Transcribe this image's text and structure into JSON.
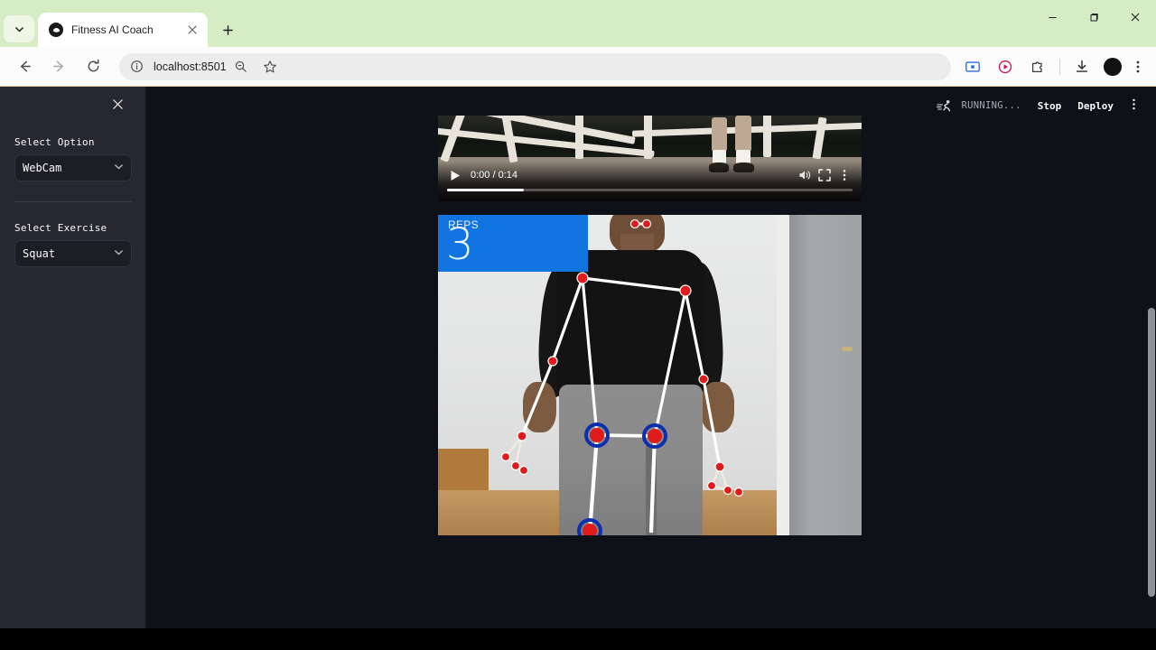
{
  "browser": {
    "tab": {
      "title": "Fitness AI Coach",
      "favicon_icon": "dark-circle-favicon",
      "close_icon": "close-icon"
    },
    "tab_list_icon": "chevron-down-icon",
    "new_tab_icon": "plus-icon",
    "window_controls": {
      "minimize_icon": "minimize-icon",
      "maximize_icon": "maximize-icon",
      "close_icon": "close-icon"
    },
    "toolbar": {
      "back_icon": "back-arrow-icon",
      "forward_icon": "forward-arrow-icon",
      "reload_icon": "reload-icon",
      "site_info_icon": "info-circle-icon",
      "url": "localhost:8501",
      "zoom_icon": "zoom-out-magnifier-icon",
      "bookmark_icon": "star-icon",
      "ext_screen_icon": "screen-capture-icon",
      "ext_record_icon": "record-play-icon",
      "ext_puzzle_icon": "extensions-puzzle-icon",
      "download_icon": "download-icon",
      "profile_icon": "profile-avatar-icon",
      "menu_icon": "kebab-menu-icon"
    },
    "tab_strip_color": "#d6ecc5",
    "accent_underline_color": "#e8c9a8"
  },
  "app": {
    "sidebar": {
      "close_icon": "close-icon",
      "controls": [
        {
          "label": "Select Option",
          "value": "WebCam",
          "caret_icon": "chevron-down-icon"
        },
        {
          "label": "Select Exercise",
          "value": "Squat",
          "caret_icon": "chevron-down-icon"
        }
      ]
    },
    "status_bar": {
      "running_icon": "running-man-icon",
      "status_text": "RUNNING...",
      "stop_label": "Stop",
      "deploy_label": "Deploy",
      "menu_icon": "kebab-menu-icon"
    },
    "video_player": {
      "play_icon": "play-icon",
      "time": "0:00 / 0:14",
      "volume_icon": "volume-icon",
      "fullscreen_icon": "fullscreen-icon",
      "menu_icon": "kebab-menu-icon",
      "progress_percent": 19
    },
    "pose_view": {
      "reps_label": "REPS",
      "reps_value": "3",
      "badge_color": "#1274e0",
      "landmark_color": "#e01b1b",
      "connector_color": "#ffffff",
      "highlight_ring_color": "#0b2fae"
    },
    "scrollbar": {
      "thumb_color": "#8e9197"
    }
  }
}
